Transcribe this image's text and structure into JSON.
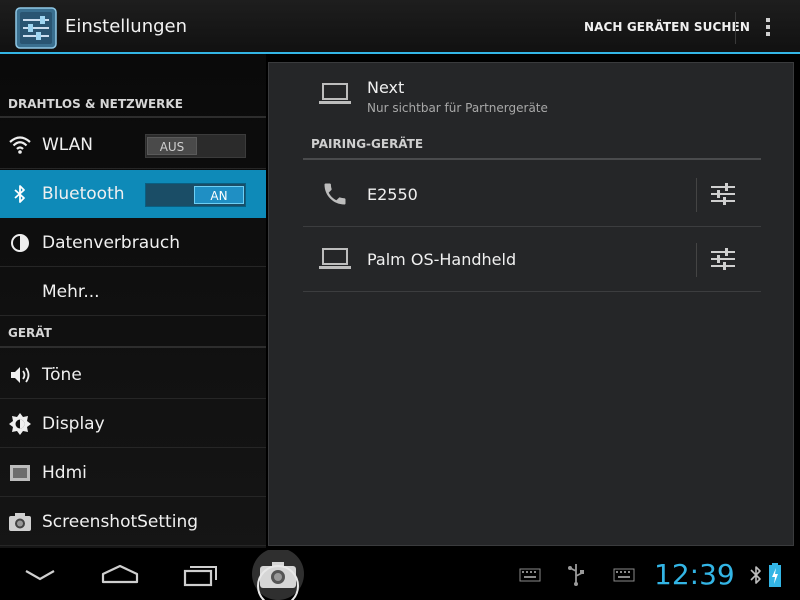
{
  "actionbar": {
    "title": "Einstellungen",
    "search_devices_label": "NACH GERÄTEN SUCHEN",
    "overflow_icon": "overflow-menu-icon",
    "app_icon": "settings-sliders-icon"
  },
  "sidebar": {
    "categories": [
      {
        "label": "DRAHTLOS & NETZWERKE"
      },
      {
        "label": "GERÄT"
      }
    ],
    "items": [
      {
        "label": "WLAN",
        "icon": "wifi-icon",
        "toggle": "AUS",
        "toggle_state": "off"
      },
      {
        "label": "Bluetooth",
        "icon": "bluetooth-icon",
        "toggle": "AN",
        "toggle_state": "on",
        "selected": true
      },
      {
        "label": "Datenverbrauch",
        "icon": "data-usage-icon"
      },
      {
        "label": "Mehr...",
        "icon": ""
      },
      {
        "label": "Töne",
        "icon": "speaker-icon"
      },
      {
        "label": "Display",
        "icon": "brightness-icon"
      },
      {
        "label": "Hdmi",
        "icon": "hdmi-icon"
      },
      {
        "label": "ScreenshotSetting",
        "icon": "camera-icon"
      }
    ]
  },
  "main": {
    "this_device": {
      "name": "Next",
      "status": "Nur sichtbar für Partnergeräte",
      "icon": "laptop-icon"
    },
    "paired_header": "PAIRING-GERÄTE",
    "paired_devices": [
      {
        "name": "E2550",
        "icon": "phone-icon",
        "settings_icon": "device-settings-icon"
      },
      {
        "name": "Palm OS-Handheld",
        "icon": "laptop-icon",
        "settings_icon": "device-settings-icon"
      }
    ]
  },
  "navbar": {
    "back_icon": "back-icon",
    "home_icon": "home-icon",
    "recents_icon": "recent-apps-icon",
    "screenshot_icon": "screenshot-icon",
    "status_icons": [
      "keyboard-icon",
      "usb-icon",
      "keyboard-icon"
    ],
    "clock": "12:39",
    "bluetooth_icon": "bluetooth-status-icon",
    "battery_icon": "battery-charging-icon"
  },
  "colors": {
    "accent": "#33b5e5",
    "selected_row": "#0e8ab8",
    "panel_bg": "#252628"
  }
}
